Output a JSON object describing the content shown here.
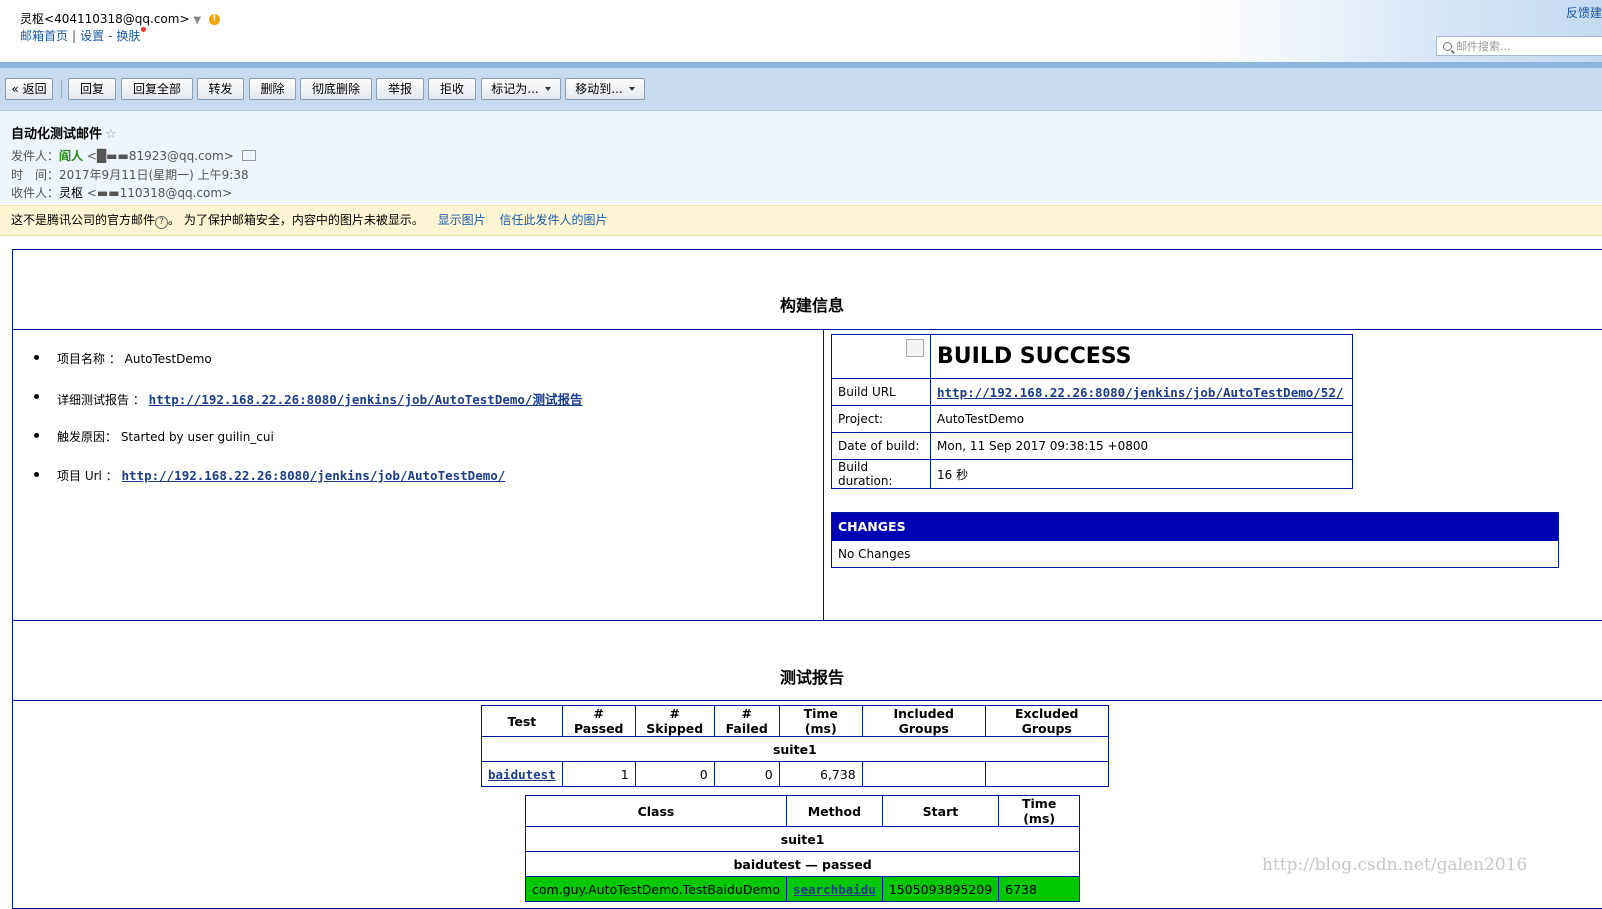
{
  "header": {
    "account_name": "灵枢",
    "account_email": "<404110318@qq.com>",
    "links": [
      "邮箱首页",
      "设置",
      "换肤"
    ],
    "feedback": "反馈建",
    "search_placeholder": "邮件搜索..."
  },
  "toolbar": {
    "buttons": [
      "« 返回",
      "回复",
      "回复全部",
      "转发",
      "删除",
      "彻底删除",
      "举报",
      "拒收",
      "标记为...",
      "移动到..."
    ]
  },
  "mail": {
    "subject": "自动化测试邮件",
    "sender_label": "发件人：",
    "sender_name": "阎人",
    "sender_email": "<█▬▬81923@qq.com>",
    "time_label": "时　间：",
    "time_value": "2017年9月11日(星期一) 上午9:38",
    "receiver_label": "收件人：",
    "receiver_name": "灵枢",
    "receiver_email": "<▬▬110318@qq.com>"
  },
  "notice": {
    "text_a": "这不是腾讯公司的官方邮件",
    "text_b": "。 为了保护邮箱安全，内容中的图片未被显示。",
    "show_images": "显示图片",
    "trust_sender": "信任此发件人的图片"
  },
  "report": {
    "build_title": "构建信息",
    "items": [
      {
        "label": "项目名称 ： AutoTestDemo",
        "link": ""
      },
      {
        "label": "详细测试报告 ： ",
        "link": "http://192.168.22.26:8080/jenkins/job/AutoTestDemo/测试报告"
      },
      {
        "label": "触发原因： Started by user guilin_cui",
        "link": ""
      },
      {
        "label": "项目 Url ： ",
        "link": "http://192.168.22.26:8080/jenkins/job/AutoTestDemo/"
      }
    ],
    "build_status": "BUILD SUCCESS",
    "build_rows": [
      {
        "k": "Build URL",
        "v": "http://192.168.22.26:8080/jenkins/job/AutoTestDemo/52/"
      },
      {
        "k": "Project:",
        "v": "AutoTestDemo"
      },
      {
        "k": "Date of build:",
        "v": "Mon, 11 Sep 2017 09:38:15 +0800"
      },
      {
        "k": "Build duration:",
        "v": "16 秒"
      }
    ],
    "changes_title": "CHANGES",
    "changes_body": "No Changes",
    "test_title": "测试报告",
    "summary_headers": [
      "Test",
      "# Passed",
      "# Skipped",
      "# Failed",
      "Time (ms)",
      "Included Groups",
      "Excluded Groups"
    ],
    "suite_name": "suite1",
    "summary_row": {
      "test": "baidutest",
      "passed": "1",
      "skipped": "0",
      "failed": "0",
      "time": "6,738",
      "included": "",
      "excluded": ""
    },
    "detail_headers": [
      "Class",
      "Method",
      "Start",
      "Time (ms)"
    ],
    "detail_suite": "suite1",
    "detail_group": "baidutest — passed",
    "detail_row": {
      "class": "com.guy.AutoTestDemo.TestBaiduDemo",
      "method": "searchbaidu",
      "start": "1505093895209",
      "time": "6738"
    }
  },
  "watermark": "http://blog.csdn.net/galen2016"
}
